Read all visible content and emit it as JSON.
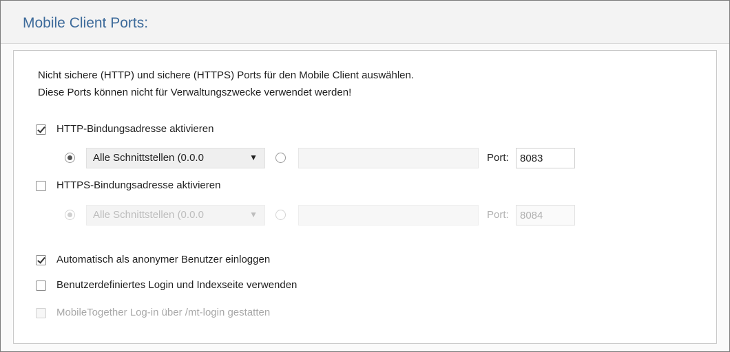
{
  "section": {
    "title": "Mobile Client Ports:"
  },
  "description": {
    "line1": "Nicht sichere (HTTP) und sichere (HTTPS) Ports für den Mobile Client auswählen.",
    "line2": "Diese Ports können nicht für Verwaltungszwecke verwendet werden!"
  },
  "http": {
    "enable_label": "HTTP-Bindungsadresse aktivieren",
    "enabled": true,
    "interface_selected": "Alle Schnittstellen (0.0.0",
    "dropdown_arrow": "▼",
    "custom_address": "",
    "port_label": "Port:",
    "port": "8083"
  },
  "https": {
    "enable_label": "HTTPS-Bindungsadresse aktivieren",
    "enabled": false,
    "interface_selected": "Alle Schnittstellen (0.0.0",
    "dropdown_arrow": "▼",
    "custom_address": "",
    "port_label": "Port:",
    "port": "8084"
  },
  "options": {
    "auto_anonymous_label": "Automatisch als anonymer Benutzer einloggen",
    "auto_anonymous_checked": true,
    "custom_login_label": "Benutzerdefiniertes Login und Indexseite verwenden",
    "custom_login_checked": false,
    "mt_login_label": "MobileTogether Log-in über /mt-login gestatten",
    "mt_login_checked": false,
    "mt_login_enabled": false
  },
  "colors": {
    "title": "#3c6a9a",
    "disabled_text": "#a8a8a8"
  }
}
